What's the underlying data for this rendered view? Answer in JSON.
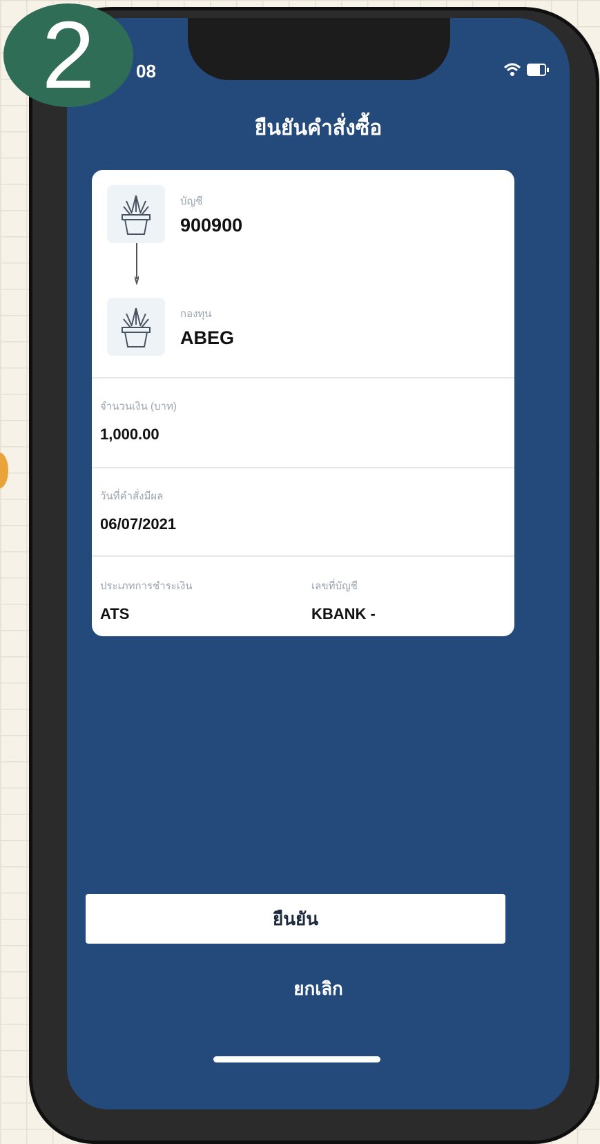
{
  "step_badge": "2",
  "status_bar": {
    "time": "08"
  },
  "screen_title": "ยืนยันคำสั่งซื้อ",
  "route": {
    "from": {
      "label": "บัญชี",
      "value": "900900",
      "icon": "plant-pot-icon"
    },
    "to": {
      "label": "กองทุน",
      "value": "ABEG",
      "icon": "plant-pot-icon"
    }
  },
  "fields": {
    "amount": {
      "label": "จำนวนเงิน (บาท)",
      "value": "1,000.00"
    },
    "date": {
      "label": "วันที่คำสั่งมีผล",
      "value": "06/07/2021"
    },
    "payment": {
      "label": "ประเภทการชำระเงิน",
      "value": "ATS"
    },
    "account": {
      "label": "เลขที่บัญชี",
      "value": "KBANK -"
    }
  },
  "actions": {
    "confirm": "ยืนยัน",
    "cancel": "ยกเลิก"
  },
  "colors": {
    "screen_bg": "#244a7c",
    "badge": "#2f6d57",
    "card": "#ffffff"
  }
}
